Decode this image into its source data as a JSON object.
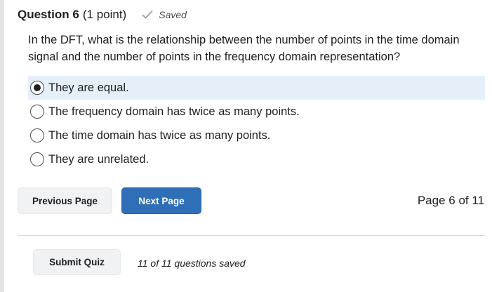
{
  "question": {
    "title": "Question 6",
    "points": "(1 point)",
    "saved_label": "Saved",
    "text": "In the DFT, what is the relationship between the number of points in the time domain signal and the number of points in the frequency domain representation?",
    "options": [
      {
        "label": "They are equal.",
        "selected": true
      },
      {
        "label": "The frequency domain has twice as many points.",
        "selected": false
      },
      {
        "label": "The time domain has twice as many points.",
        "selected": false
      },
      {
        "label": "They are unrelated.",
        "selected": false
      }
    ]
  },
  "navigation": {
    "previous_label": "Previous Page",
    "next_label": "Next Page",
    "page_indicator": "Page 6 of 11"
  },
  "footer": {
    "submit_label": "Submit Quiz",
    "saved_count": "11 of 11 questions saved"
  },
  "colors": {
    "selected_bg": "#e4effa",
    "primary_button": "#2f6fb8",
    "secondary_button": "#f1f2f3"
  },
  "icons": {
    "saved": "check-icon"
  }
}
